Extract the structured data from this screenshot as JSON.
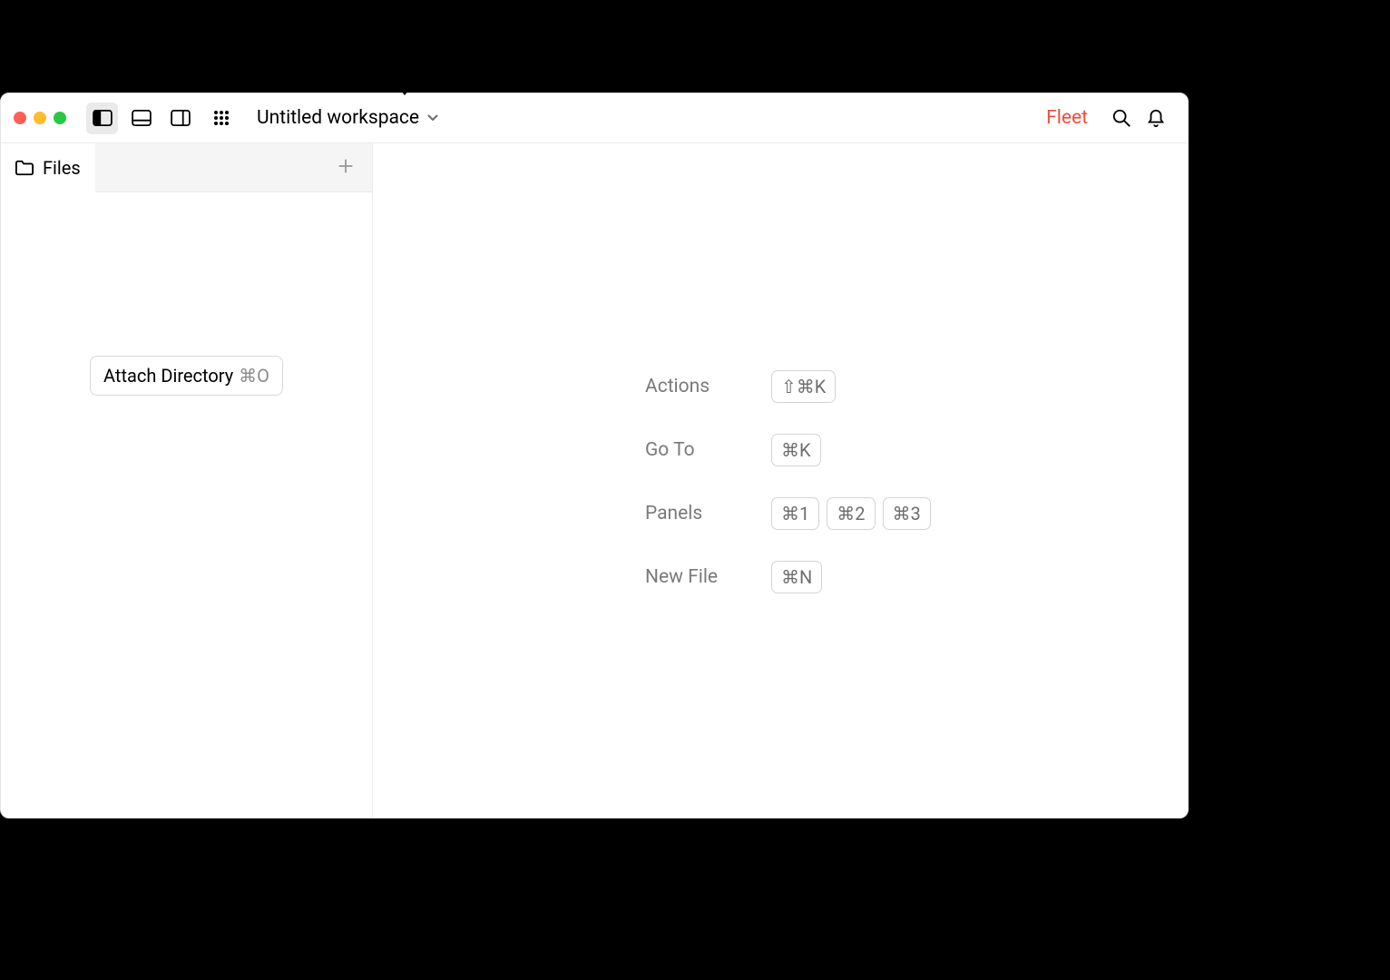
{
  "titlebar": {
    "workspace_title": "Untitled workspace",
    "brand": "Fleet"
  },
  "sidebar": {
    "tab_label": "Files",
    "attach_button": {
      "label": "Attach Directory",
      "shortcut": "⌘O"
    }
  },
  "hints": [
    {
      "label": "Actions",
      "keys": [
        "⇧⌘K"
      ]
    },
    {
      "label": "Go To",
      "keys": [
        "⌘K"
      ]
    },
    {
      "label": "Panels",
      "keys": [
        "⌘1",
        "⌘2",
        "⌘3"
      ]
    },
    {
      "label": "New File",
      "keys": [
        "⌘N"
      ]
    }
  ]
}
